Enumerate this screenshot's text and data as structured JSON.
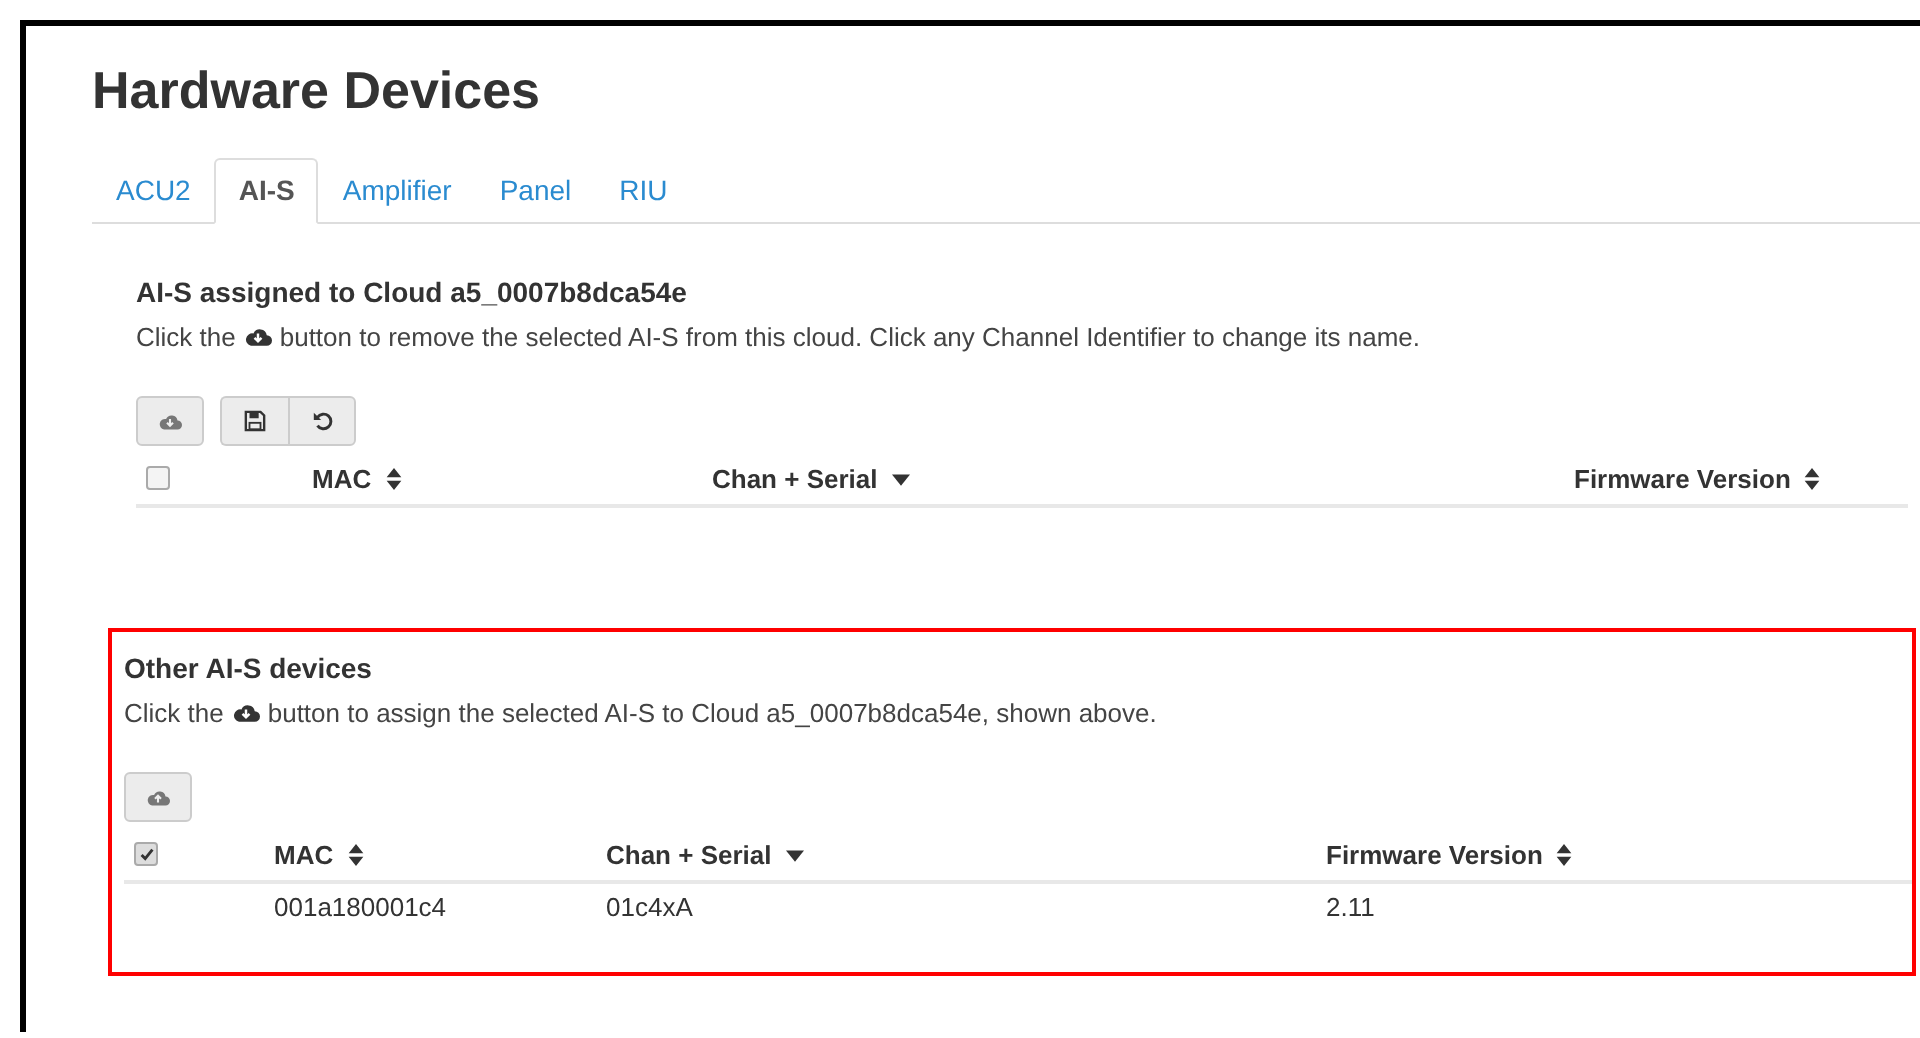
{
  "title": "Hardware Devices",
  "tabs": [
    {
      "label": "ACU2",
      "selected": false
    },
    {
      "label": "AI-S",
      "selected": true
    },
    {
      "label": "Amplifier",
      "selected": false
    },
    {
      "label": "Panel",
      "selected": false
    },
    {
      "label": "RIU",
      "selected": false
    }
  ],
  "sections": [
    {
      "heading": "AI-S assigned to Cloud a5_0007b8dca54e",
      "text_before": "Click the",
      "text_after": "button to remove the selected AI-S from this cloud. Click any Channel Identifier to change its name.",
      "highlighted": false,
      "button_groups": [
        {
          "buttons": [
            {
              "kind": "cloud-down"
            }
          ]
        },
        {
          "buttons": [
            {
              "kind": "save"
            },
            {
              "kind": "undo"
            }
          ]
        }
      ],
      "select_all": {
        "checked": false
      },
      "columns": [
        {
          "label": "MAC",
          "kind": "sortable"
        },
        {
          "label": "Chan + Serial",
          "kind": "sorted"
        },
        {
          "label": "Firmware Version",
          "kind": "sortable"
        }
      ]
    },
    {
      "heading": "Other AI-S devices",
      "text_before": "Click the",
      "text_after": "button to assign the selected AI-S to Cloud a5_0007b8dca54e, shown above.",
      "highlighted": true,
      "button_groups": [
        {
          "buttons": [
            {
              "kind": "cloud-up"
            }
          ]
        }
      ],
      "select_all": {
        "checked": true
      },
      "columns": [
        {
          "label": "MAC",
          "kind": "sortable"
        },
        {
          "label": "Chan + Serial",
          "kind": "sorted"
        },
        {
          "label": "Firmware Version",
          "kind": "sortable"
        }
      ],
      "rows": [
        {
          "cells": [
            "001a180001c4",
            "01c4xA",
            "2.11"
          ]
        }
      ]
    }
  ]
}
